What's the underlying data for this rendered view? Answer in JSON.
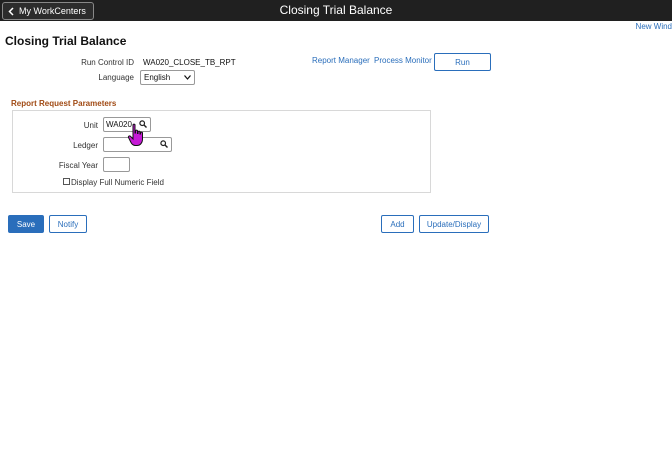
{
  "header": {
    "back_label": "My WorkCenters",
    "title": "Closing Trial Balance"
  },
  "new_window_link": "New Wind",
  "page_title": "Closing Trial Balance",
  "run_control": {
    "label": "Run Control ID",
    "value": "WA020_CLOSE_TB_RPT"
  },
  "language": {
    "label": "Language",
    "selected": "English"
  },
  "links": {
    "report_manager": "Report Manager",
    "process_monitor": "Process Monitor"
  },
  "run_button": "Run",
  "params": {
    "section_title": "Report Request Parameters",
    "unit": {
      "label": "Unit",
      "value": "WA020"
    },
    "ledger": {
      "label": "Ledger",
      "value": ""
    },
    "fiscal_year": {
      "label": "Fiscal Year",
      "value": ""
    },
    "display_full_numeric": {
      "label": "Display Full Numeric Field",
      "checked": false
    }
  },
  "footer_buttons": {
    "save": "Save",
    "notify": "Notify",
    "add": "Add",
    "update_display": "Update/Display"
  },
  "colors": {
    "link": "#2a6ebb",
    "section_title": "#a04a14",
    "header_bg": "#202020"
  }
}
